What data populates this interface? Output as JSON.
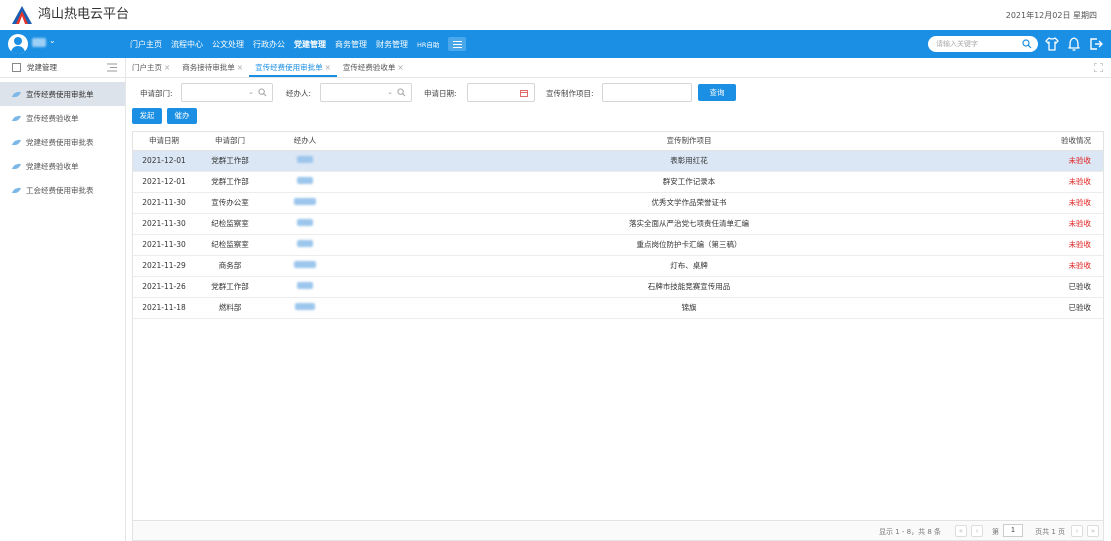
{
  "app": {
    "title": "鸿山热电云平台",
    "date": "2021年12月02日 星期四"
  },
  "topnav": {
    "menu": [
      "门户主页",
      "流程中心",
      "公文处理",
      "行政办公",
      "党建管理",
      "商务管理",
      "财务管理",
      "HR自助"
    ],
    "active_index": 4,
    "search_placeholder": "请输入关键字"
  },
  "sidebar": {
    "title": "党建管理",
    "items": [
      "宣传经费使用审批单",
      "宣传经费验收单",
      "党建经费使用审批表",
      "党建经费验收单",
      "工会经费使用审批表"
    ],
    "active_index": 0
  },
  "tabs": [
    {
      "label": "门户主页",
      "active": false
    },
    {
      "label": "商务接待审批单",
      "active": false
    },
    {
      "label": "宣传经费使用审批单",
      "active": true
    },
    {
      "label": "宣传经费验收单",
      "active": false
    }
  ],
  "filters": {
    "dept_label": "申请部门:",
    "handler_label": "经办人:",
    "date_label": "申请日期:",
    "project_label": "宣传制作项目:",
    "query_button": "查询"
  },
  "actions": {
    "start": "发起",
    "todo": "催办"
  },
  "table": {
    "headers": [
      "申请日期",
      "申请部门",
      "经办人",
      "宣传制作项目",
      "验收情况"
    ],
    "rows": [
      {
        "date": "2021-12-01",
        "dept": "党群工作部",
        "project": "表彰用红花",
        "status": "未验收"
      },
      {
        "date": "2021-12-01",
        "dept": "党群工作部",
        "project": "群安工作记录本",
        "status": "未验收"
      },
      {
        "date": "2021-11-30",
        "dept": "宣传办公室",
        "project": "优秀文学作品荣誉证书",
        "status": "未验收"
      },
      {
        "date": "2021-11-30",
        "dept": "纪检监察室",
        "project": "落实全面从严治党七项责任清单汇编",
        "status": "未验收"
      },
      {
        "date": "2021-11-30",
        "dept": "纪检监察室",
        "project": "重点岗位防护卡汇编（第三稿）",
        "status": "未验收"
      },
      {
        "date": "2021-11-29",
        "dept": "商务部",
        "project": "灯布、桌牌",
        "status": "未验收"
      },
      {
        "date": "2021-11-26",
        "dept": "党群工作部",
        "project": "石牌市技能竞赛宣传用品",
        "status": "已验收"
      },
      {
        "date": "2021-11-18",
        "dept": "燃料部",
        "project": "锦旗",
        "status": "已验收"
      }
    ]
  },
  "pager": {
    "summary": "显示 1 - 8，共 8 条",
    "page_prefix": "第",
    "page_value": "1",
    "page_suffix": "页共 1 页"
  },
  "colors": {
    "primary": "#1a8fe3",
    "pending": "#e02020"
  }
}
